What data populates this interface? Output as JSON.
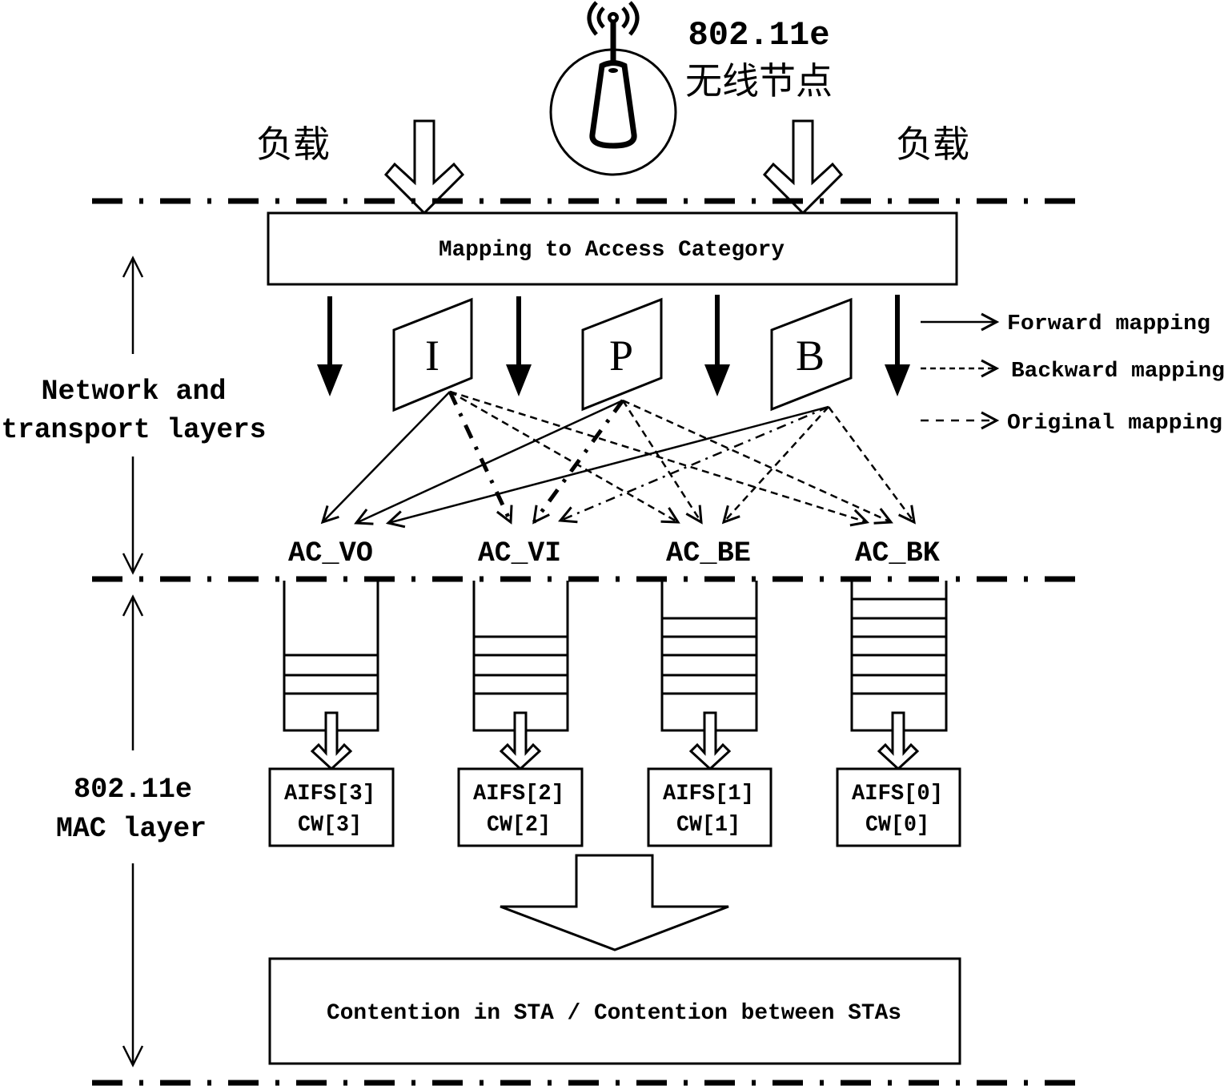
{
  "node": {
    "standard": "802.11e",
    "title": "无线节点",
    "icon": "wireless-antenna-icon"
  },
  "load_labels": [
    "负载",
    "负载"
  ],
  "mapping_box": "Mapping to Access Category",
  "frames": [
    {
      "id": "I",
      "label": "I"
    },
    {
      "id": "P",
      "label": "P"
    },
    {
      "id": "B",
      "label": "B"
    }
  ],
  "legend": [
    {
      "type": "forward",
      "label": "Forward mapping",
      "line": "solid"
    },
    {
      "type": "backward",
      "label": "Backward mapping",
      "line": "dashed"
    },
    {
      "type": "original",
      "label": "Original mapping",
      "line": "dash-dot"
    }
  ],
  "layers": {
    "upper": [
      "Network and",
      "transport layers"
    ],
    "lower": [
      "802.11e",
      "MAC layer"
    ]
  },
  "access_categories": [
    {
      "id": "AC_VO",
      "label": "AC_VO",
      "queued_packets": 3,
      "aifs": "AIFS[3]",
      "cw": "CW[3]"
    },
    {
      "id": "AC_VI",
      "label": "AC_VI",
      "queued_packets": 4,
      "aifs": "AIFS[2]",
      "cw": "CW[2]"
    },
    {
      "id": "AC_BE",
      "label": "AC_BE",
      "queued_packets": 5,
      "aifs": "AIFS[1]",
      "cw": "CW[1]"
    },
    {
      "id": "AC_BK",
      "label": "AC_BK",
      "queued_packets": 6,
      "aifs": "AIFS[0]",
      "cw": "CW[0]"
    }
  ],
  "mappings": [
    {
      "from": "I",
      "to": "AC_VO",
      "type": "forward"
    },
    {
      "from": "P",
      "to": "AC_VO",
      "type": "forward"
    },
    {
      "from": "B",
      "to": "AC_VO",
      "type": "forward"
    },
    {
      "from": "I",
      "to": "AC_VI",
      "type": "original"
    },
    {
      "from": "P",
      "to": "AC_VI",
      "type": "original"
    },
    {
      "from": "B",
      "to": "AC_VI",
      "type": "original"
    },
    {
      "from": "I",
      "to": "AC_BE",
      "type": "backward"
    },
    {
      "from": "P",
      "to": "AC_BE",
      "type": "backward"
    },
    {
      "from": "B",
      "to": "AC_BE",
      "type": "backward"
    },
    {
      "from": "I",
      "to": "AC_BK",
      "type": "backward"
    },
    {
      "from": "P",
      "to": "AC_BK",
      "type": "backward"
    },
    {
      "from": "B",
      "to": "AC_BK",
      "type": "backward"
    }
  ],
  "contention_box": "Contention in STA / Contention between STAs",
  "colors": {
    "ink": "#000000",
    "background": "#ffffff"
  }
}
